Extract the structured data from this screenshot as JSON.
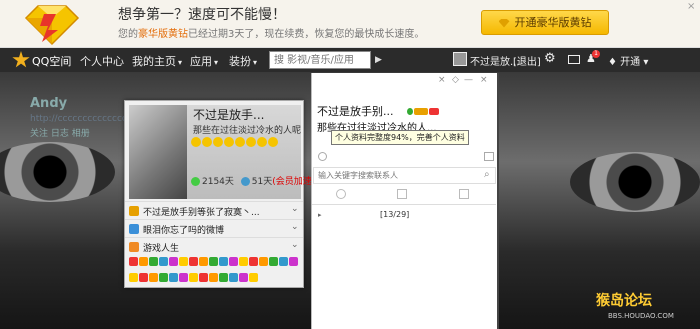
{
  "banner": {
    "title": "想争第一？速度可不能慢！",
    "sub_prefix": "您的",
    "sub_hl": "豪华版黄钻",
    "sub_mid": "已经过期3天了，现在续费，恢复您的最快成长速度。",
    "button": "开通豪华版黄钻",
    "close": "×"
  },
  "nav": {
    "logo": "QQ空间",
    "items": [
      "个人中心",
      "我的主页",
      "应用",
      "装扮"
    ],
    "search_placeholder": "搜 影视/音乐/应用",
    "search_btn": "▶",
    "user": "不过是放...",
    "exit": "[退出]",
    "badge": "1",
    "ktong": "开通"
  },
  "bg": {
    "name": "Andy",
    "url": "http://ccccccccccccccccccccccccc",
    "links": "关注  日志  相册"
  },
  "card": {
    "name": "不过是放手...",
    "signature": "那些在过往淡过冷水的人呢...",
    "days_left": "2154天",
    "days_right": "51天",
    "days_note": "(会员加速中)",
    "rows": [
      {
        "label": "不过是放手别等张了寂寞丶...",
        "color": "#e6a000"
      },
      {
        "label": "眼泪你忘了吗的微博",
        "color": "#3a8fd8"
      },
      {
        "label": "游戏人生",
        "color": "#f08a24"
      }
    ],
    "icon_colors": [
      "#e33",
      "#f90",
      "#3a3",
      "#39c",
      "#c3c",
      "#fc0",
      "#e33",
      "#f90",
      "#3a3",
      "#39c",
      "#c3c",
      "#fc0",
      "#e33",
      "#f90",
      "#3a3",
      "#39c",
      "#c3c",
      "#fc0",
      "#e33",
      "#f90",
      "#3a3",
      "#39c",
      "#c3c",
      "#fc0",
      "#e33",
      "#f90",
      "#3a3",
      "#39c",
      "#c3c",
      "#fc0"
    ]
  },
  "panel": {
    "name": "不过是放手别...",
    "signature": "那些在过往淡过冷水的人...",
    "tooltip": "个人资料完整度94%，完善个人资料",
    "search_placeholder": "输入关键字搜索联系人",
    "pager": "[13/29]"
  },
  "watermark": {
    "main": "猴岛论坛",
    "sub": "BBS.HOUDAO.COM"
  }
}
